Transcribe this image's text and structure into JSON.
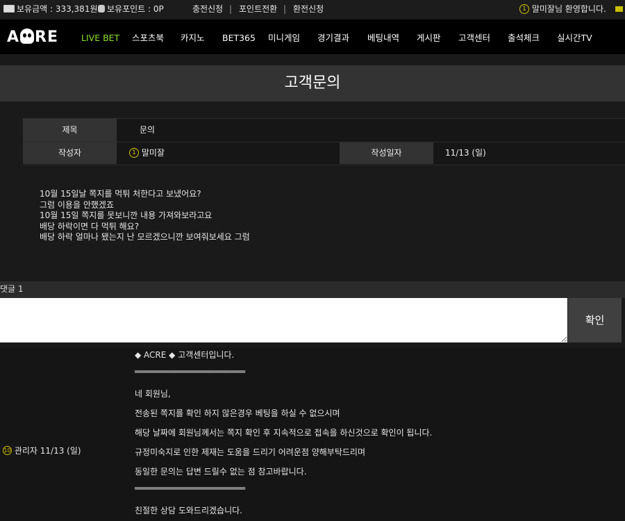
{
  "topbar": {
    "balance": "보유금액 : 333,381원",
    "points": "보유포인트 : 0P",
    "links": [
      "충전신청",
      "포인트전환",
      "환전신청"
    ],
    "separator": "|",
    "user_level": "1",
    "welcome": "말미잘님 환영합니다."
  },
  "nav": {
    "logo": [
      "A",
      "RE"
    ],
    "items": [
      "LIVE BET",
      "스포츠북",
      "카지노",
      "BET365",
      "미니게임",
      "경기결과",
      "베팅내역",
      "게시판",
      "고객센터",
      "출석체크",
      "실시간TV"
    ]
  },
  "page": {
    "title": "고객문의"
  },
  "post": {
    "subject_label": "제목",
    "subject": "문의",
    "author_label": "작성자",
    "author_level": "1",
    "author": "말미잘",
    "date_label": "작성일자",
    "date": "11/13 (일)",
    "body": [
      "10월 15일날 쪽지를 먹튀 처한다고 보냈어요?",
      "그럼 이용을 안했겠죠",
      "10월 15일 쪽지를 못보니깐 내용 가져와보라고요",
      "배당 하락이면 다 먹튀 해요?",
      "배당 하락 얼마나 됐는지 난 모르겠으니깐 보여줘보세요 그럼"
    ]
  },
  "comments": {
    "label": "댓글 1",
    "input_value": "",
    "confirm_label": "확인",
    "reply": {
      "admin_level": "10",
      "admin": "관리자 11/13 (일)",
      "lines": [
        "◆ ACRE ◆ 고객센터입니다.",
        "══════════════════════",
        "네 회원님,",
        "전송된 쪽지를 확인 하지 않은경우 베팅을 하실 수 없으시며",
        "해당 날짜에 회원님께서는 쪽지 확인 후 지속적으로 접속을 하신것으로 확인이 됩니다.",
        "규정미숙지로 인한 제재는 도움을 드리기 어려운점 양해부탁드리며",
        "동일한 문의는 답변 드릴수 없는 점 참고바랍니다.",
        "══════════════════════",
        "친절한 상담 도와드리겠습니다."
      ]
    }
  }
}
